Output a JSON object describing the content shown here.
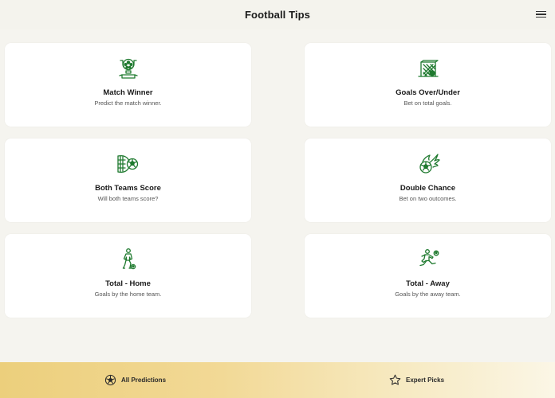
{
  "header": {
    "title": "Football Tips",
    "menu_icon": "hamburger-menu-icon"
  },
  "colors": {
    "accent": "#1f7a2f",
    "bottom_bar_start": "#eccf7c",
    "bottom_bar_end": "#fbf6e6",
    "background": "#f5f4ef"
  },
  "cards": [
    {
      "title": "Match Winner",
      "subtitle": "Predict the match winner.",
      "icon": "trophy-icon"
    },
    {
      "title": "Goals Over/Under",
      "subtitle": "Bet on total goals.",
      "icon": "goal-net-icon"
    },
    {
      "title": "Both Teams Score",
      "subtitle": "Will both teams score?",
      "icon": "ball-in-net-icon"
    },
    {
      "title": "Double Chance",
      "subtitle": "Bet on two outcomes.",
      "icon": "flaming-ball-icon"
    },
    {
      "title": "Total - Home",
      "subtitle": "Goals by the home team.",
      "icon": "player-dribbling-icon"
    },
    {
      "title": "Total - Away",
      "subtitle": "Goals by the away team.",
      "icon": "player-kicking-icon"
    }
  ],
  "bottom_nav": {
    "tabs": [
      {
        "label": "All Predictions",
        "icon": "soccer-ball-icon"
      },
      {
        "label": "Expert Picks",
        "icon": "star-icon"
      }
    ]
  }
}
